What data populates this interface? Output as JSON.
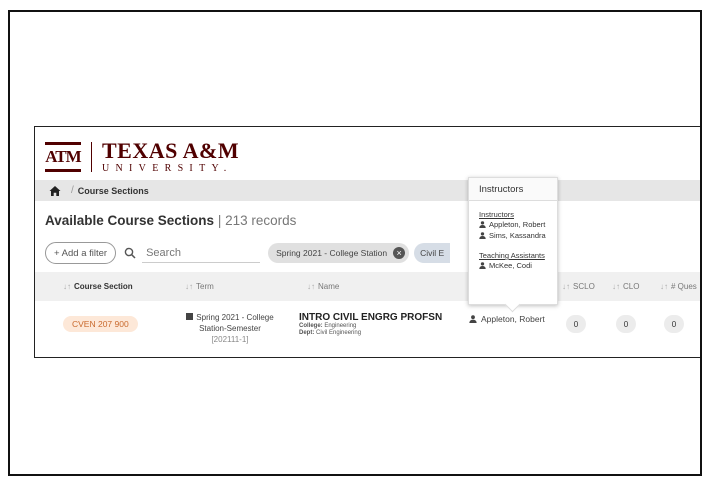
{
  "logo": {
    "mark": "ATM",
    "line1": "TEXAS A&M",
    "line2": "UNIVERSITY."
  },
  "breadcrumb": {
    "sep": "/",
    "current": "Course Sections"
  },
  "title": {
    "main": "Available Course Sections",
    "count": "| 213 records"
  },
  "filters": {
    "add_label": "+ Add a filter",
    "search_placeholder": "Search",
    "chip_term": "Spring 2021 - College Station",
    "chip_x": "×",
    "chip_civil": "Civil E"
  },
  "table": {
    "columns": {
      "course_section": "Course Section",
      "term": "Term",
      "name": "Name",
      "sclo": "SCLO",
      "clo": "CLO",
      "questions": "# Ques"
    },
    "row": {
      "section": "CVEN 207 900",
      "term_line1": "Spring 2021 - College",
      "term_line2": "Station-Semester",
      "term_code": "[202111-1]",
      "name": "INTRO CIVIL ENGRG PROFSN",
      "college_label": "College:",
      "college": "Engineering",
      "dept_label": "Dept:",
      "dept": "Civil Engineering",
      "instructor": "Appleton, Robert",
      "sclo": "0",
      "clo": "0",
      "questions": "0"
    }
  },
  "popover": {
    "title": "Instructors",
    "instructors_heading": "Instructors",
    "instructors": [
      "Appleton, Robert",
      "Sims, Kassandra"
    ],
    "tas_heading": "Teaching Assistants",
    "tas": [
      "McKee, Codi"
    ]
  },
  "colors": {
    "brand": "#500000",
    "badge_bg": "#fde8d8",
    "badge_text": "#c96a2e"
  },
  "icons": [
    "home-icon",
    "search-icon",
    "person-icon",
    "calendar-icon",
    "close-icon",
    "sort-icon"
  ]
}
